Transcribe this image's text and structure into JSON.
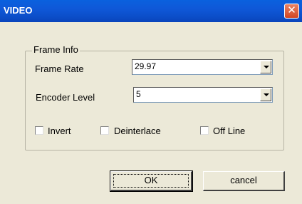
{
  "window": {
    "title": "VIDEO"
  },
  "group": {
    "title": "Frame Info"
  },
  "frame_rate": {
    "label": "Frame Rate",
    "value": "29.97"
  },
  "encoder_level": {
    "label": "Encoder Level",
    "value": "5"
  },
  "checkboxes": {
    "invert": {
      "label": "Invert",
      "checked": false
    },
    "deinterlace": {
      "label": "Deinterlace",
      "checked": false
    },
    "offline": {
      "label": "Off Line",
      "checked": false
    }
  },
  "buttons": {
    "ok": "OK",
    "cancel": "cancel"
  }
}
